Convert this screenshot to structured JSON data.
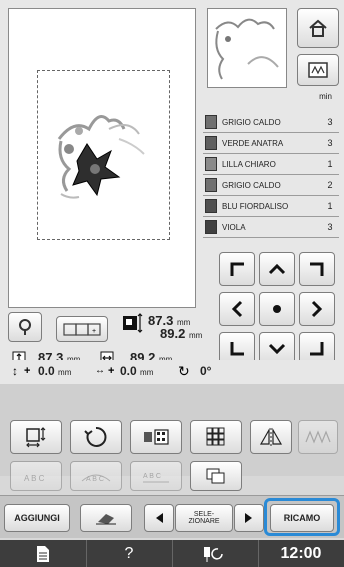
{
  "threads": [
    {
      "name": "GRIGIO CALDO",
      "count": "3",
      "color": "#707070"
    },
    {
      "name": "VERDE ANATRA",
      "count": "3",
      "color": "#606060"
    },
    {
      "name": "LILLA CHIARO",
      "count": "1",
      "color": "#8a8a8a"
    },
    {
      "name": "GRIGIO CALDO",
      "count": "2",
      "color": "#707070"
    },
    {
      "name": "BLU FIORDALISO",
      "count": "1",
      "color": "#505050"
    },
    {
      "name": "VIOLA",
      "count": "3",
      "color": "#404040"
    }
  ],
  "thread_header": "min",
  "size": {
    "w_value": "87.3",
    "w_unit": "mm",
    "h_value": "89.2",
    "h_unit": "mm"
  },
  "dims": {
    "val1": "87.3",
    "unit1": "mm",
    "val2": "89.2",
    "unit2": "mm"
  },
  "offset": {
    "x": "0.0",
    "xunit": "mm",
    "y": "0.0",
    "yunit": "mm",
    "angle": "0°"
  },
  "bottom": {
    "aggiungi": "AGGIUNGI",
    "selezionare": "SELE-\nZIONARE",
    "ricamo": "RICAMO"
  },
  "status": {
    "question": "?",
    "time": "12:00"
  }
}
